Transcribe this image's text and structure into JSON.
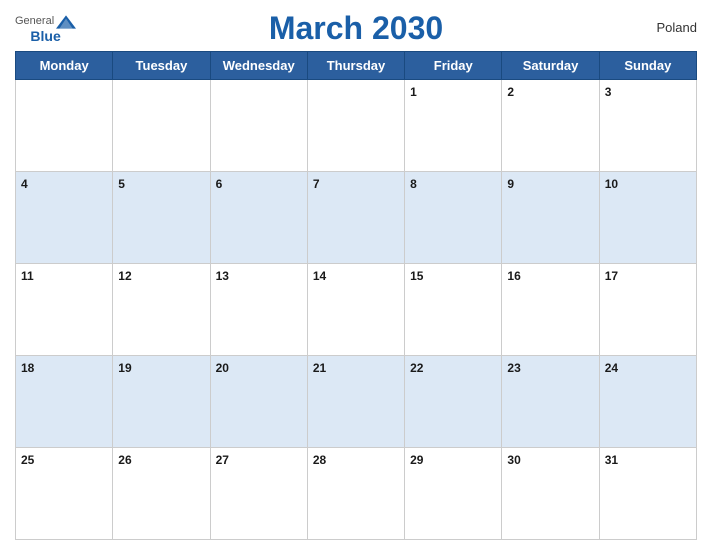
{
  "header": {
    "title": "March 2030",
    "country": "Poland",
    "logo_general": "General",
    "logo_blue": "Blue"
  },
  "weekdays": [
    "Monday",
    "Tuesday",
    "Wednesday",
    "Thursday",
    "Friday",
    "Saturday",
    "Sunday"
  ],
  "weeks": [
    [
      null,
      null,
      null,
      null,
      1,
      2,
      3
    ],
    [
      4,
      5,
      6,
      7,
      8,
      9,
      10
    ],
    [
      11,
      12,
      13,
      14,
      15,
      16,
      17
    ],
    [
      18,
      19,
      20,
      21,
      22,
      23,
      24
    ],
    [
      25,
      26,
      27,
      28,
      29,
      30,
      31
    ]
  ]
}
